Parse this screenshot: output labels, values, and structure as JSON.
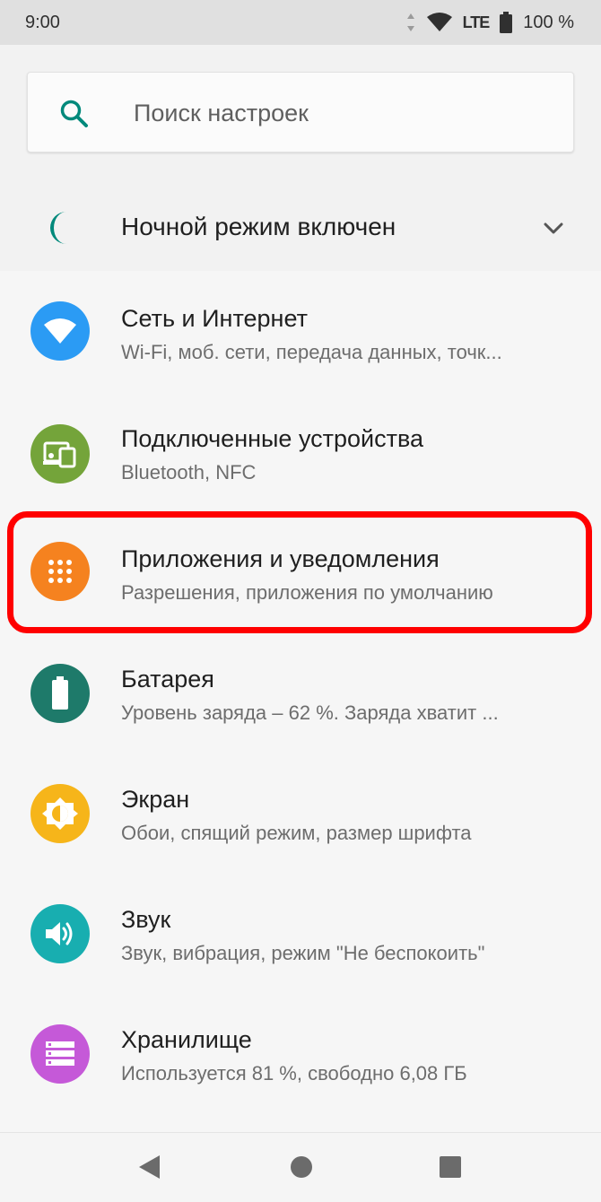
{
  "status_bar": {
    "time": "9:00",
    "network": "LTE",
    "battery": "100 %"
  },
  "search": {
    "placeholder": "Поиск настроек",
    "value": ""
  },
  "night_mode": {
    "label": "Ночной режим включен",
    "icon": "moon-icon"
  },
  "settings": [
    {
      "title": "Сеть и Интернет",
      "subtitle": "Wi-Fi, моб. сети, передача данных, точк...",
      "icon": "wifi-icon",
      "color": "#2b9bf4"
    },
    {
      "title": "Подключенные устройства",
      "subtitle": "Bluetooth, NFC",
      "icon": "devices-icon",
      "color": "#74a43a"
    },
    {
      "title": "Приложения и уведомления",
      "subtitle": "Разрешения, приложения по умолчанию",
      "icon": "apps-grid-icon",
      "color": "#f5821f"
    },
    {
      "title": "Батарея",
      "subtitle": "Уровень заряда – 62 %. Заряда хватит ...",
      "icon": "battery-icon",
      "color": "#1e7a6a"
    },
    {
      "title": "Экран",
      "subtitle": "Обои, спящий режим, размер шрифта",
      "icon": "brightness-icon",
      "color": "#f6b51a"
    },
    {
      "title": "Звук",
      "subtitle": "Звук, вибрация, режим \"Не беспокоить\"",
      "icon": "volume-icon",
      "color": "#18aeb0"
    },
    {
      "title": "Хранилище",
      "subtitle": "Используется 81 %, свободно 6,08 ГБ",
      "icon": "storage-icon",
      "color": "#c559d8"
    }
  ],
  "colors": {
    "accent": "#00897b",
    "highlight": "#ff0000"
  }
}
